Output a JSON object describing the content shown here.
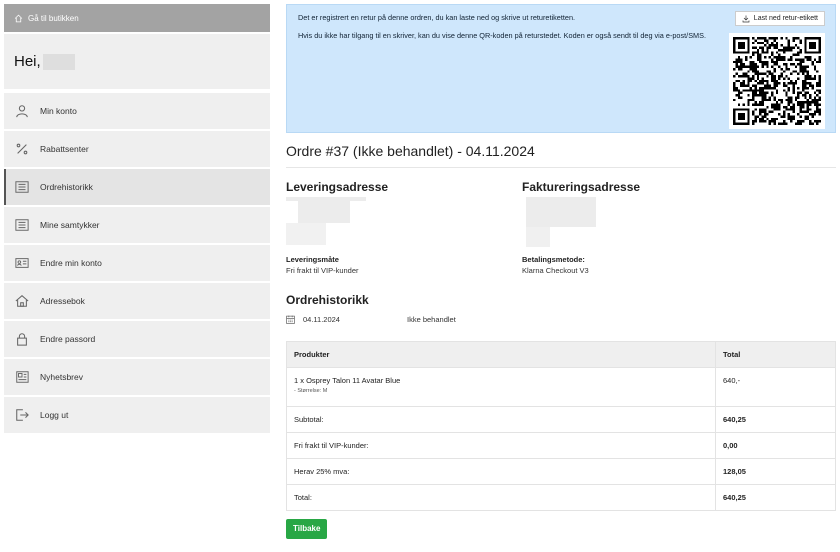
{
  "sidebar": {
    "back_label": "Gå til butikken",
    "greeting": "Hei,",
    "items": [
      {
        "label": "Min konto",
        "icon": "user-icon"
      },
      {
        "label": "Rabattsenter",
        "icon": "percent-icon"
      },
      {
        "label": "Ordrehistorikk",
        "icon": "list-icon",
        "active": true
      },
      {
        "label": "Mine samtykker",
        "icon": "list-icon"
      },
      {
        "label": "Endre min konto",
        "icon": "id-card-icon"
      },
      {
        "label": "Adressebok",
        "icon": "home-icon"
      },
      {
        "label": "Endre passord",
        "icon": "lock-icon"
      },
      {
        "label": "Nyhetsbrev",
        "icon": "newspaper-icon"
      },
      {
        "label": "Logg ut",
        "icon": "logout-icon"
      }
    ]
  },
  "notice": {
    "line1": "Det er registrert en retur på denne ordren, du kan laste ned og skrive ut returetiketten.",
    "line2": "Hvis du ikke har tilgang til en skriver, kan du vise denne QR-koden på returstedet. Koden er også sendt til deg via e-post/SMS.",
    "download_label": "Last ned retur-etikett"
  },
  "order": {
    "title": "Ordre #37 (Ikke behandlet) - 04.11.2024",
    "delivery_heading": "Leveringsadresse",
    "billing_heading": "Faktureringsadresse",
    "shipping_label": "Leveringsmåte",
    "shipping_value": "Fri frakt til VIP-kunder",
    "payment_label": "Betalingsmetode:",
    "payment_value": "Klarna Checkout V3",
    "history_heading": "Ordrehistorikk",
    "history": [
      {
        "date": "04.11.2024",
        "status": "Ikke behandlet"
      }
    ]
  },
  "table": {
    "col_product": "Produkter",
    "col_total": "Total",
    "product_name": "1 x Osprey Talon 11 Avatar Blue",
    "product_meta": "- Størrelse: M",
    "product_total": "640,-",
    "rows": [
      {
        "label": "Subtotal:",
        "value": "640,25"
      },
      {
        "label": "Fri frakt til VIP-kunder:",
        "value": "0,00"
      },
      {
        "label": "Herav 25% mva:",
        "value": "128,05"
      },
      {
        "label": "Total:",
        "value": "640,25"
      }
    ]
  },
  "back_button": "Tilbake",
  "colors": {
    "notice_bg": "#cfe7fc",
    "button_green": "#28a745",
    "sidebar_bg": "#efefef"
  }
}
